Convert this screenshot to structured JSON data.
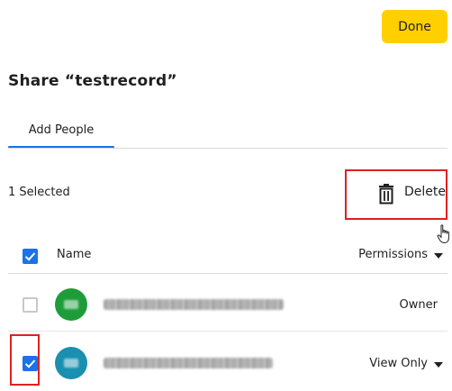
{
  "header": {
    "done_label": "Done",
    "title": "Share “testrecord”"
  },
  "tabs": [
    {
      "label": "Add People",
      "active": true
    }
  ],
  "selection": {
    "count_label": "1 Selected",
    "delete_label": "Delete"
  },
  "table": {
    "header_checked": true,
    "col_name": "Name",
    "col_permissions": "Permissions"
  },
  "rows": [
    {
      "checked": false,
      "avatar_color": "#1e9c3a",
      "email_obscured": true,
      "permission": "Owner",
      "has_dropdown": false
    },
    {
      "checked": true,
      "avatar_color": "#1a8fb0",
      "email_obscured": true,
      "permission": "View Only",
      "has_dropdown": true
    }
  ],
  "colors": {
    "accent": "#1a73e8",
    "done_button": "#ffcf00",
    "highlight_box": "#e02020"
  },
  "icons": {
    "delete": "trash-icon",
    "cursor": "hand-pointer-icon",
    "dropdown": "caret-down-icon",
    "check": "checkmark-icon"
  }
}
